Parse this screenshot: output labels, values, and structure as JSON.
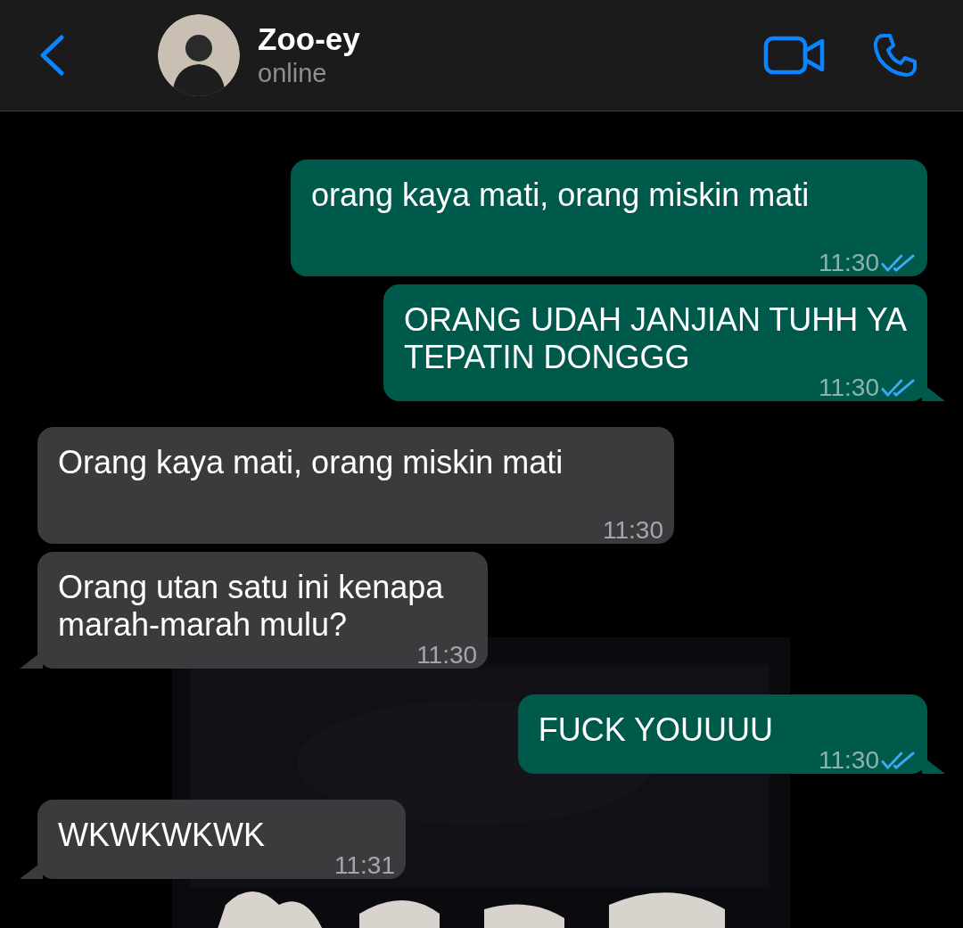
{
  "contact": {
    "name": "Zoo-ey",
    "status": "online"
  },
  "messages": [
    {
      "kind": "outgoing",
      "text": "orang kaya mati, orang miskin mati",
      "time": "11:30",
      "read": true,
      "tail": false
    },
    {
      "kind": "outgoing",
      "text": "ORANG UDAH JANJIAN TUHH YA\nTEPATIN DONGGG",
      "time": "11:30",
      "read": true,
      "tail": true
    },
    {
      "kind": "incoming",
      "text": "Orang kaya mati, orang miskin mati",
      "time": "11:30",
      "tail": false
    },
    {
      "kind": "incoming",
      "text": "Orang utan satu ini kenapa\nmarah-marah mulu?",
      "time": "11:30",
      "tail": true
    },
    {
      "kind": "outgoing",
      "text": "FUCK YOUUUU",
      "time": "11:30",
      "read": true,
      "tail": true
    },
    {
      "kind": "incoming",
      "text": "WKWKWKWK",
      "time": "11:31",
      "tail": true
    }
  ]
}
